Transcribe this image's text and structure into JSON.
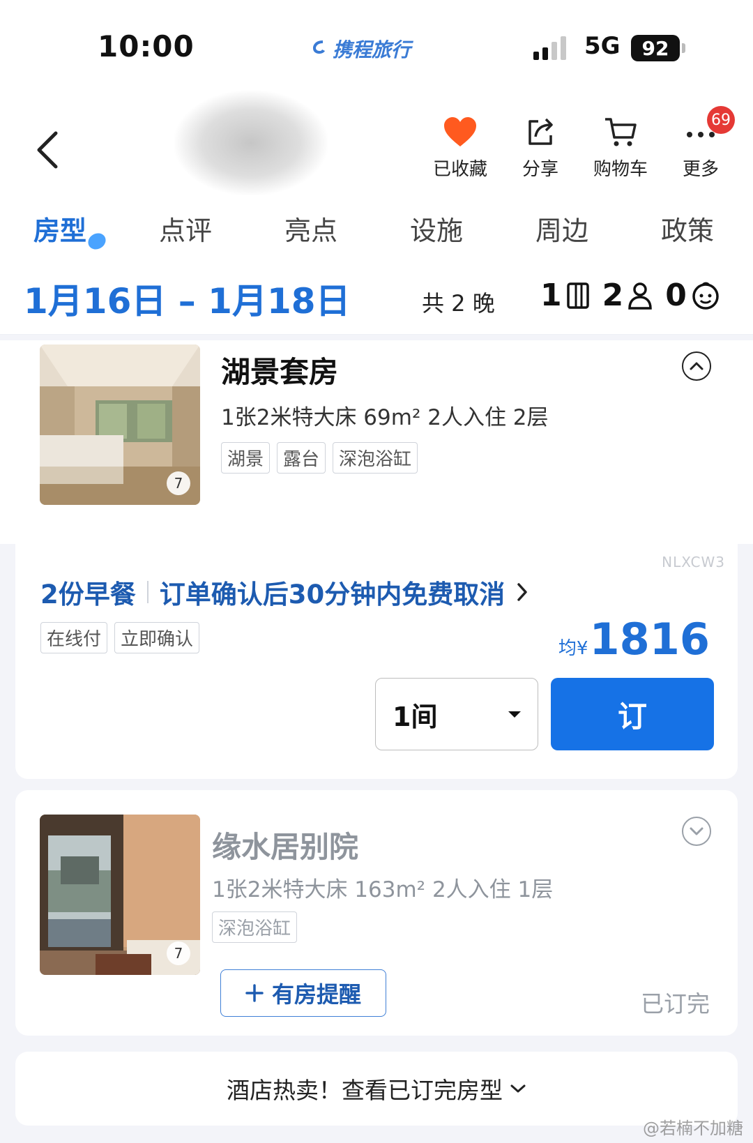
{
  "status": {
    "time": "10:00",
    "carrier": "携程旅行",
    "network": "5G",
    "battery": "92"
  },
  "header": {
    "actions": [
      {
        "label": "已收藏",
        "icon": "heart-icon"
      },
      {
        "label": "分享",
        "icon": "share-icon"
      },
      {
        "label": "购物车",
        "icon": "cart-icon"
      },
      {
        "label": "更多",
        "icon": "more-icon"
      }
    ],
    "more_badge": "69"
  },
  "tabs": [
    "房型",
    "点评",
    "亮点",
    "设施",
    "周边",
    "政策"
  ],
  "datebar": {
    "dates": "1月16日 – 1月18日",
    "nights": "共 2 晚",
    "rooms": "1",
    "adults": "2",
    "children": "0"
  },
  "room1": {
    "name": "湖景套房",
    "spec": "1张2米特大床  69m²  2人入住  2层",
    "tags": [
      "湖景",
      "露台",
      "深泡浴缸"
    ],
    "photo_count": "7"
  },
  "offer": {
    "code": "NLXCW3",
    "breakfast": "2份早餐",
    "cancel": "订单确认后30分钟内免费取消",
    "tags": [
      "在线付",
      "立即确认"
    ],
    "price_prefix": "均¥",
    "price": "1816",
    "qty": "1间",
    "book_label": "订"
  },
  "room2": {
    "name": "缘水居别院",
    "spec": "1张2米特大床  163m²  2人入住  1层",
    "tags": [
      "深泡浴缸"
    ],
    "photo_count": "7",
    "remind_label": "有房提醒",
    "soldout": "已订完"
  },
  "footer": {
    "label": "酒店热卖！查看已订完房型"
  },
  "watermark": "@若楠不加糖",
  "colors": {
    "accent": "#1672e6",
    "heart": "#ff5a1f"
  }
}
